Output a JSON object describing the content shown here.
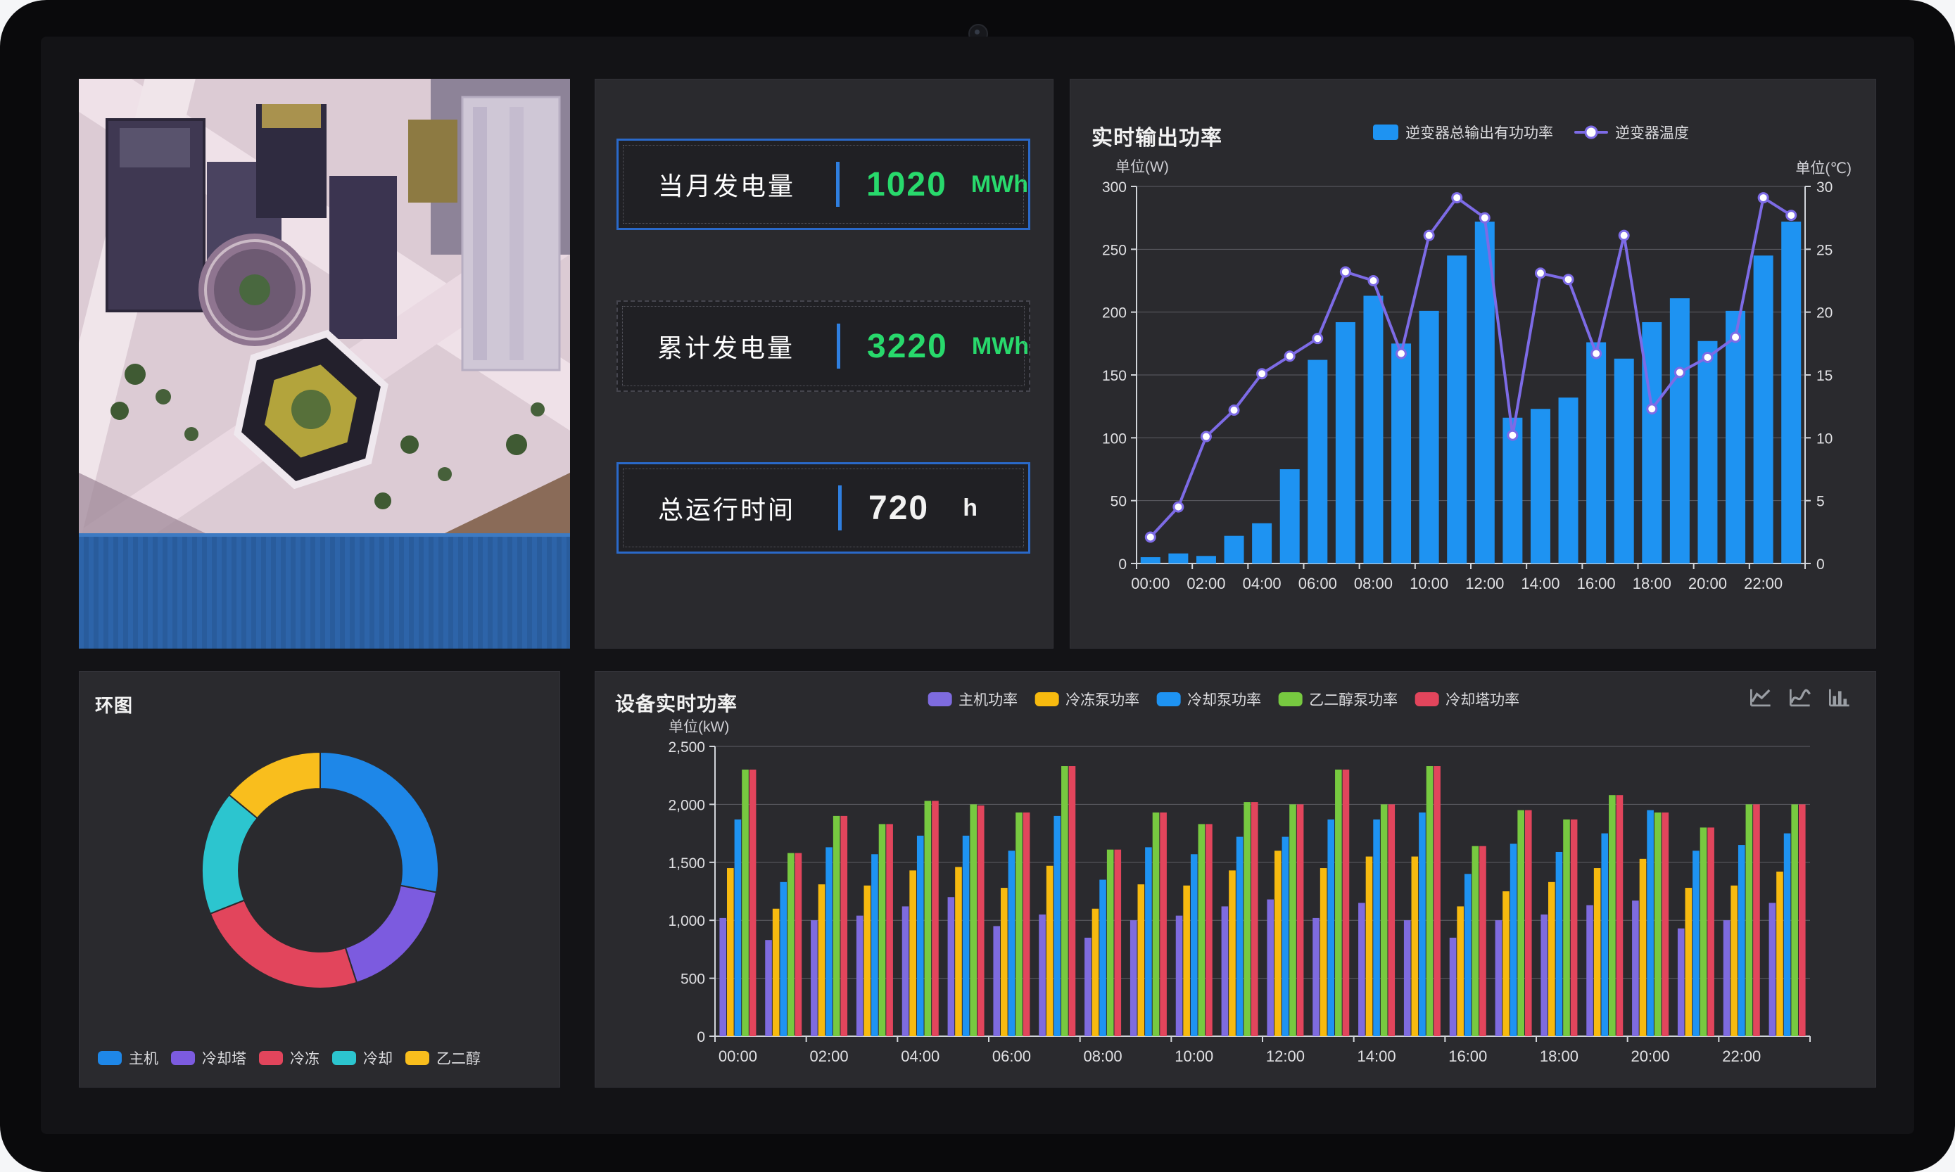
{
  "stats": {
    "cards": [
      {
        "label": "当月发电量",
        "value": "1020",
        "unit": "MWh"
      },
      {
        "label": "累计发电量",
        "value": "3220",
        "unit": "MWh"
      },
      {
        "label": "总运行时间",
        "value": "720",
        "unit": "h"
      }
    ],
    "divider_color": "#2F7FE0",
    "value_color_green": "#28D96C"
  },
  "device_panel_toolbox": [
    "line-chart",
    "smooth-chart",
    "bar-chart"
  ],
  "chart_data": [
    {
      "id": "inverter_power",
      "type": "bar",
      "title": "实时输出功率",
      "legend_position": "top",
      "grid": true,
      "x": [
        "00:00",
        "01:00",
        "02:00",
        "03:00",
        "04:00",
        "05:00",
        "06:00",
        "07:00",
        "08:00",
        "09:00",
        "10:00",
        "11:00",
        "12:00",
        "13:00",
        "14:00",
        "15:00",
        "16:00",
        "17:00",
        "18:00",
        "19:00",
        "20:00",
        "21:00",
        "22:00",
        "23:00"
      ],
      "x_tick_labels": [
        "00:00",
        "02:00",
        "04:00",
        "06:00",
        "08:00",
        "10:00",
        "12:00",
        "14:00",
        "16:00",
        "18:00",
        "20:00",
        "22:00"
      ],
      "y_left": {
        "label": "单位(W)",
        "min": 0,
        "max": 300,
        "ticks": [
          "0",
          "50",
          "100",
          "150",
          "200",
          "250",
          "300"
        ]
      },
      "y_right": {
        "label": "单位(℃)",
        "min": 0,
        "max": 30,
        "ticks": [
          "0",
          "5",
          "10",
          "15",
          "20",
          "25",
          "30"
        ]
      },
      "series": [
        {
          "name": "逆变器总输出有功功率",
          "type": "bar",
          "axis": "left",
          "color": "#1E93F2",
          "values": [
            5,
            8,
            6,
            22,
            32,
            75,
            162,
            192,
            213,
            175,
            201,
            245,
            272,
            116,
            123,
            132,
            176,
            163,
            192,
            211,
            177,
            201,
            245,
            272
          ]
        },
        {
          "name": "逆变器温度",
          "type": "line",
          "axis": "right",
          "color": "#7D6BE6",
          "values": [
            2.1,
            4.5,
            10.1,
            12.2,
            15.1,
            16.5,
            17.9,
            23.2,
            22.5,
            16.7,
            26.1,
            29.1,
            27.5,
            10.2,
            23.1,
            22.6,
            16.7,
            26.1,
            12.3,
            15.2,
            16.4,
            18.0,
            29.1,
            27.7
          ]
        }
      ]
    },
    {
      "id": "ring",
      "type": "pie",
      "title": "环图",
      "legend_position": "bottom",
      "inner_radius_ratio": 0.69,
      "slices": [
        {
          "name": "主机",
          "value": 28,
          "color": "#1E87E8"
        },
        {
          "name": "冷却塔",
          "value": 17,
          "color": "#7C5BDF"
        },
        {
          "name": "冷冻",
          "value": 24,
          "color": "#E2455C"
        },
        {
          "name": "冷却",
          "value": 17,
          "color": "#2CC5CF"
        },
        {
          "name": "乙二醇",
          "value": 14,
          "color": "#F9BE1D"
        }
      ]
    },
    {
      "id": "device_power",
      "type": "bar",
      "title": "设备实时功率",
      "ylabel": "单位(kW)",
      "ylim": [
        0,
        2500
      ],
      "y_ticks": [
        "0",
        "500",
        "1,000",
        "1,500",
        "2,000",
        "2,500"
      ],
      "legend_position": "top",
      "grid": true,
      "x": [
        "00:00",
        "01:00",
        "02:00",
        "03:00",
        "04:00",
        "05:00",
        "06:00",
        "07:00",
        "08:00",
        "09:00",
        "10:00",
        "11:00",
        "12:00",
        "13:00",
        "14:00",
        "15:00",
        "16:00",
        "17:00",
        "18:00",
        "19:00",
        "20:00",
        "21:00",
        "22:00",
        "23:00"
      ],
      "x_tick_labels": [
        "00:00",
        "02:00",
        "04:00",
        "06:00",
        "08:00",
        "10:00",
        "12:00",
        "14:00",
        "16:00",
        "18:00",
        "20:00",
        "22:00"
      ],
      "series": [
        {
          "name": "主机功率",
          "color": "#7E6BDF",
          "values": [
            1020,
            830,
            1000,
            1040,
            1120,
            1200,
            950,
            1050,
            850,
            1000,
            1040,
            1120,
            1180,
            1020,
            1150,
            1000,
            850,
            1000,
            1050,
            1130,
            1170,
            930,
            1000,
            1150
          ]
        },
        {
          "name": "冷冻泵功率",
          "color": "#F7BA0F",
          "values": [
            1450,
            1100,
            1310,
            1300,
            1430,
            1460,
            1280,
            1470,
            1100,
            1310,
            1300,
            1430,
            1600,
            1450,
            1550,
            1550,
            1120,
            1250,
            1330,
            1450,
            1530,
            1280,
            1300,
            1420
          ]
        },
        {
          "name": "冷却泵功率",
          "color": "#1E93F2",
          "values": [
            1870,
            1330,
            1630,
            1570,
            1730,
            1730,
            1600,
            1900,
            1350,
            1630,
            1570,
            1720,
            1720,
            1870,
            1870,
            1930,
            1400,
            1660,
            1590,
            1750,
            1950,
            1600,
            1650,
            1750
          ]
        },
        {
          "name": "乙二醇泵功率",
          "color": "#77C940",
          "values": [
            2300,
            1580,
            1900,
            1830,
            2030,
            2000,
            1930,
            2330,
            1610,
            1930,
            1830,
            2020,
            2000,
            2300,
            2000,
            2330,
            1640,
            1950,
            1870,
            2080,
            1930,
            1800,
            2000,
            2000
          ]
        },
        {
          "name": "冷却塔功率",
          "color": "#E2455C",
          "values": [
            2300,
            1580,
            1900,
            1830,
            2030,
            1990,
            1930,
            2330,
            1610,
            1930,
            1830,
            2020,
            2000,
            2300,
            2000,
            2330,
            1640,
            1950,
            1870,
            2080,
            1930,
            1800,
            2000,
            2000
          ]
        }
      ]
    }
  ]
}
